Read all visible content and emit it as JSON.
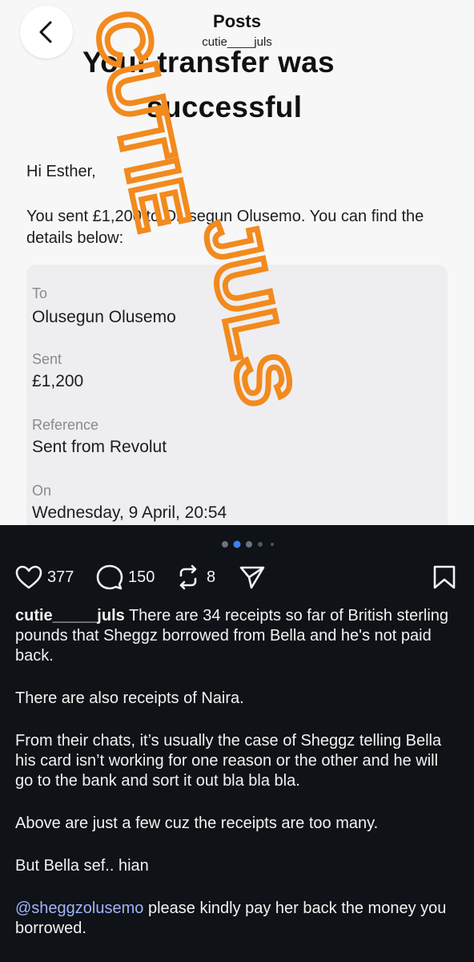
{
  "header": {
    "title": "Posts",
    "subtitle": "cutie____juls",
    "back_icon": "chevron-left-icon"
  },
  "document": {
    "title_line1": "Your transfer was",
    "title_line2": "successful",
    "greeting": "Hi Esther,",
    "body": "You sent £1,200 to Olusegun Olusemo. You can find the details below:",
    "fields": [
      {
        "label": "To",
        "value": "Olusegun Olusemo"
      },
      {
        "label": "Sent",
        "value": "£1,200"
      },
      {
        "label": "Reference",
        "value": "Sent from Revolut"
      },
      {
        "label": "On",
        "value": "Wednesday, 9 April, 20:54"
      }
    ],
    "watermark": "CUTIE JULS",
    "watermark_color": "#f28a1d"
  },
  "carousel": {
    "total_dots": 5,
    "active_index": 1
  },
  "actions": {
    "likes": "377",
    "comments": "150",
    "reposts": "8"
  },
  "caption": {
    "username": "cutie_____juls",
    "text": "There are 34 receipts so far of British sterling pounds that Sheggz borrowed from Bella and he's not paid back.",
    "paragraphs": [
      "There are also receipts of Naira.",
      "From their chats, it’s usually the case of Sheggz telling Bella his card isn’t working for one reason or the other and he will go to the bank and sort it out bla bla bla.",
      "Above are just a few cuz the receipts are too many.",
      "But Bella sef.. hian"
    ],
    "mention": "@sheggzolusemo",
    "mention_text": " please kindly pay her back the money you borrowed."
  },
  "colors": {
    "dark_bg": "#0f1216",
    "mention": "#9fb3ff"
  }
}
